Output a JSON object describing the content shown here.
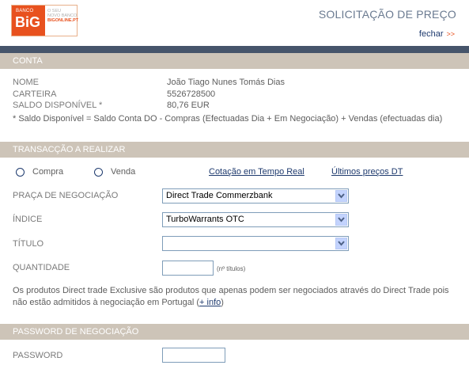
{
  "header": {
    "logo": {
      "banco": "BANCO",
      "big": "BiG",
      "line1": "O SEU",
      "line2": "NOVO BANCO",
      "site": "BIGONLINE.PT"
    },
    "title": "SOLICITAÇÃO DE PREÇO",
    "close_label": "fechar",
    "close_arrows": ">>"
  },
  "conta": {
    "section_title": "CONTA",
    "rows": [
      {
        "label": "NOME",
        "value": "João Tiago Nunes Tomás Dias"
      },
      {
        "label": "CARTEIRA",
        "value": "5526728500"
      },
      {
        "label": "SALDO DISPONÍVEL *",
        "value": "80,76 EUR"
      }
    ],
    "footnote": "* Saldo Disponível = Saldo Conta DO - Compras (Efectuadas Dia + Em Negociação) + Vendas (efectuadas dia)"
  },
  "transaccao": {
    "section_title": "TRANSACÇÃO A REALIZAR",
    "radio_buy": "Compra",
    "radio_sell": "Venda",
    "link_quote": "Cotação em Tempo Real",
    "link_last": "Últimos preços DT",
    "praca_label": "PRAÇA DE NEGOCIAÇÃO",
    "praca_value": "Direct Trade Commerzbank",
    "indice_label": "ÍNDICE",
    "indice_value": "TurboWarrants OTC",
    "titulo_label": "TÍTULO",
    "titulo_value": "",
    "quantidade_label": "QUANTIDADE",
    "quantidade_value": "",
    "quantidade_hint": "(nº títulos)",
    "info_text": "Os produtos Direct trade Exclusive são produtos que apenas podem ser negociados através do Direct Trade pois não estão admitidos à negociação em Portugal (",
    "info_link": "+ info",
    "info_close": ")"
  },
  "password": {
    "section_title": "PASSWORD DE NEGOCIAÇÃO",
    "label": "PASSWORD",
    "value": ""
  },
  "colors": {
    "brand": "#e8511e",
    "bar": "#46556b",
    "section": "#cdc4b8",
    "link": "#1e3a6e"
  }
}
